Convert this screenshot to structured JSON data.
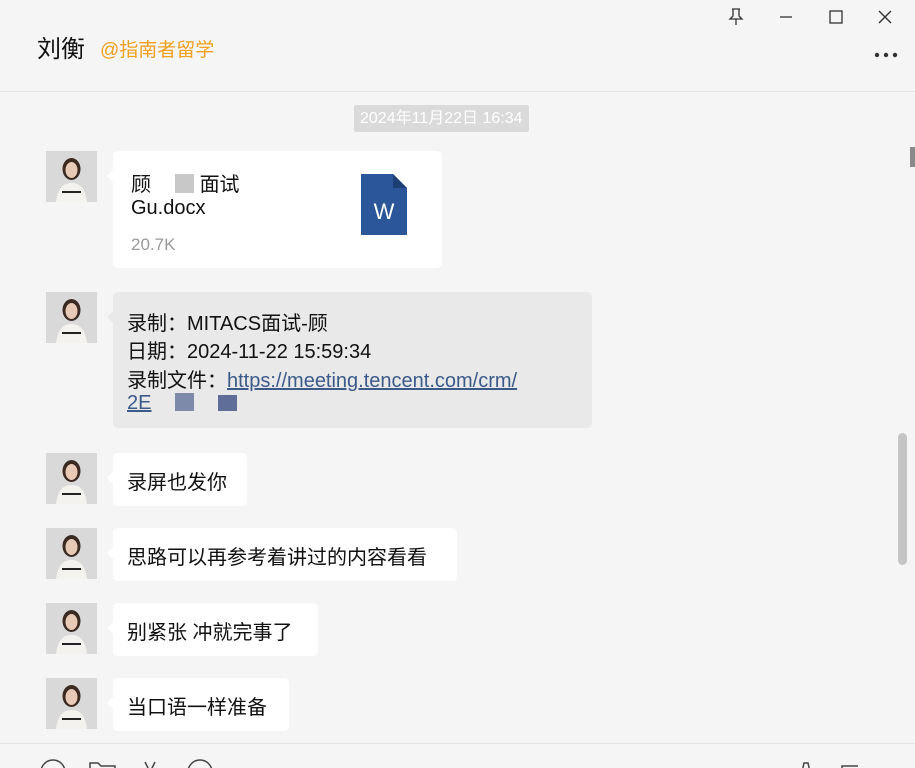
{
  "header": {
    "contact_name": "刘衡",
    "contact_org": "@指南者留学"
  },
  "timestamp": "2024年11月22日 16:34",
  "messages": [
    {
      "type": "file",
      "file_name_line1": "顾",
      "file_name_line1_tail": "面试",
      "file_name_line2": "Gu.docx",
      "file_size": "20.7K",
      "file_icon": "word-icon",
      "file_icon_letter": "W"
    },
    {
      "type": "text",
      "line1": "录制：MITACS面试-顾",
      "line2": "日期：2024-11-22 15:59:34",
      "line3_label": "录制文件：",
      "line3_link": "https://meeting.tencent.com/crm/",
      "line4_link": "2E"
    },
    {
      "type": "text",
      "text": "录屏也发你"
    },
    {
      "type": "text",
      "text": "思路可以再参考着讲过的内容看看"
    },
    {
      "type": "text",
      "text": "别紧张 冲就完事了"
    },
    {
      "type": "text",
      "text": "当口语一样准备"
    }
  ],
  "icons": {
    "pin": "pin-icon",
    "minimize": "minimize-icon",
    "maximize": "maximize-icon",
    "close": "close-icon",
    "more": "more-icon"
  },
  "colors": {
    "org_accent": "#f0a020",
    "word_blue": "#2b579a",
    "link": "#3b5a8a"
  }
}
